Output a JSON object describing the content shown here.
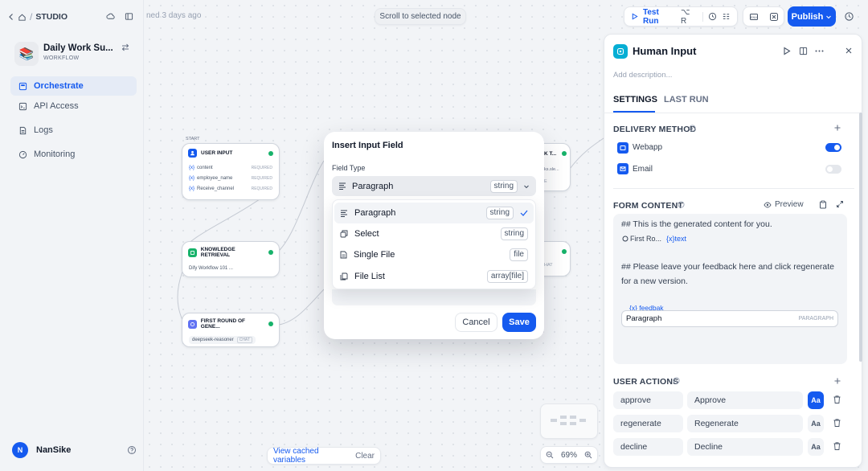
{
  "topbar": {
    "breadcrumb_studio": "STUDIO",
    "autosave_text": "ned 3 days ago",
    "scroll_btn": "Scroll to selected node",
    "test_run": "Test Run",
    "shortcut": "⌥ R",
    "publish": "Publish"
  },
  "app": {
    "name": "Daily Work Su...",
    "type": "WORKFLOW"
  },
  "sidebar": {
    "items": [
      {
        "label": "Orchestrate",
        "icon": "orchestrate-icon",
        "active": true
      },
      {
        "label": "API Access",
        "icon": "api-icon"
      },
      {
        "label": "Logs",
        "icon": "logs-icon"
      },
      {
        "label": "Monitoring",
        "icon": "monitoring-icon"
      }
    ],
    "user_initial": "N",
    "user_name": "NanSike"
  },
  "canvas": {
    "start_label": "START",
    "user_input": {
      "title": "USER INPUT",
      "rows": [
        {
          "name": "content",
          "req": "REQUIRED"
        },
        {
          "name": "employee_name",
          "req": "REQUIRED"
        },
        {
          "name": "Receive_channel",
          "req": "REQUIRED"
        }
      ]
    },
    "knowledge": {
      "title": "KNOWLEDGE RETRIEVAL",
      "sub": "Dify Workflow 101 ..."
    },
    "first_round": {
      "title": "FIRST ROUND OF GENE...",
      "model": "deepseek-reasoner",
      "tag": "CHAT"
    },
    "right_node_top": {
      "title": "K T...",
      "sub": "ks.sle...",
      "tag": "E"
    },
    "right_node_mid": {
      "tag": "HAT"
    },
    "view_cached": "View cached variables",
    "clear": "Clear",
    "zoom": "69%"
  },
  "panel": {
    "title": "Human Input",
    "description_placeholder": "Add description...",
    "tabs": {
      "settings": "SETTINGS",
      "last_run": "LAST RUN"
    },
    "delivery": {
      "title": "DELIVERY METHOD",
      "methods": [
        {
          "label": "Webapp",
          "on": true
        },
        {
          "label": "Email",
          "on": false
        }
      ]
    },
    "form": {
      "title": "FORM CONTENT",
      "preview": "Preview",
      "line1": "## This is the generated content for you.",
      "var1": "First Ro...",
      "var2": "text",
      "line2": "## Please leave your feedback here and click regenerate",
      "line3": "for a new version.",
      "field_var": "feedbak",
      "field_label": "Paragraph",
      "field_type": "PARAGRAPH"
    },
    "actions": {
      "title": "USER ACTIONS",
      "items": [
        {
          "id": "approve",
          "label": "Approve"
        },
        {
          "id": "regenerate",
          "label": "Regenerate"
        },
        {
          "id": "decline",
          "label": "Decline"
        }
      ]
    }
  },
  "modal": {
    "title": "Insert Input Field",
    "field_type_label": "Field Type",
    "selected": {
      "label": "Paragraph",
      "type": "string"
    },
    "options": [
      {
        "label": "Paragraph",
        "type": "string",
        "selected": true
      },
      {
        "label": "Select",
        "type": "string"
      },
      {
        "label": "Single File",
        "type": "file"
      },
      {
        "label": "File List",
        "type": "array[file]"
      }
    ],
    "cancel": "Cancel",
    "save": "Save"
  },
  "colors": {
    "accent": "#155aef",
    "success": "#17b26a",
    "text": "#101828"
  }
}
